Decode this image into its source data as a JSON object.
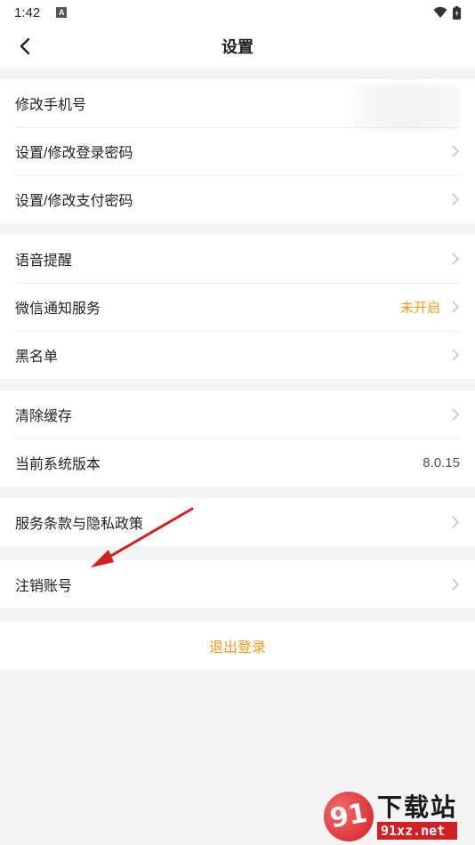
{
  "status_bar": {
    "time": "1:42",
    "notification_icon": "A"
  },
  "header": {
    "title": "设置",
    "back_icon": "chevron-left-icon"
  },
  "groups": [
    {
      "rows": [
        {
          "label": "修改手机号",
          "value": "",
          "value_obscured": true,
          "chevron": false
        },
        {
          "label": "设置/修改登录密码",
          "value": "",
          "chevron": true
        },
        {
          "label": "设置/修改支付密码",
          "value": "",
          "chevron": true
        }
      ]
    },
    {
      "rows": [
        {
          "label": "语音提醒",
          "value": "",
          "chevron": true
        },
        {
          "label": "微信通知服务",
          "value": "未开启",
          "chevron": true
        },
        {
          "label": "黑名单",
          "value": "",
          "chevron": true
        }
      ]
    },
    {
      "rows": [
        {
          "label": "清除缓存",
          "value": "",
          "chevron": true
        },
        {
          "label": "当前系统版本",
          "value": "8.0.15",
          "chevron": false
        }
      ]
    },
    {
      "rows": [
        {
          "label": "服务条款与隐私政策",
          "value": "",
          "chevron": true
        }
      ]
    },
    {
      "rows": [
        {
          "label": "注销账号",
          "value": "",
          "chevron": true
        }
      ]
    }
  ],
  "logout": {
    "label": "退出登录"
  },
  "watermark": {
    "logo": "91",
    "cn": "下载站",
    "en": "91xz.net"
  },
  "colors": {
    "accent": "#f09b1a",
    "background": "#f4f4f4",
    "annotation_arrow": "#d61f1f"
  }
}
